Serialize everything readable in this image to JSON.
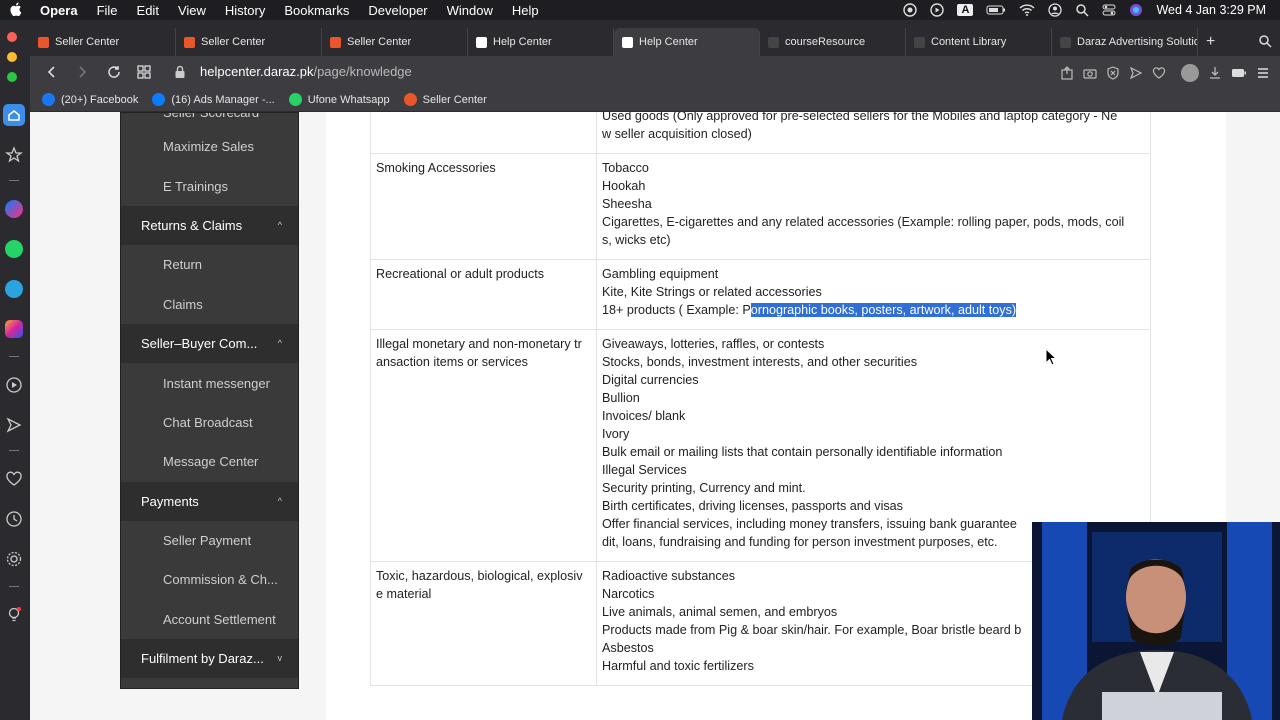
{
  "menubar": {
    "app": "Opera",
    "items": [
      "File",
      "Edit",
      "View",
      "History",
      "Bookmarks",
      "Developer",
      "Window",
      "Help"
    ],
    "input_badge": "A",
    "clock": "Wed 4 Jan  3:29 PM"
  },
  "tabs": [
    {
      "label": "Seller Center",
      "color": "#e8562a",
      "width": 146
    },
    {
      "label": "Seller Center",
      "color": "#e8562a",
      "width": 146
    },
    {
      "label": "Seller Center",
      "color": "#e8562a",
      "width": 146
    },
    {
      "label": "Help Center",
      "color": "#ffffff",
      "width": 146
    },
    {
      "label": "Help Center",
      "color": "#ffffff",
      "width": 146,
      "active": true
    },
    {
      "label": "courseResource",
      "color": "#444444",
      "width": 146
    },
    {
      "label": "Content Library",
      "color": "#444444",
      "width": 146
    },
    {
      "label": "Daraz Advertising Solutio",
      "color": "#444444",
      "width": 146
    }
  ],
  "address": {
    "domain": "helpcenter.daraz.pk",
    "path": "/page/knowledge"
  },
  "bookmarks": [
    {
      "label": "(20+) Facebook",
      "color": "#1877f2"
    },
    {
      "label": "(16) Ads Manager -...",
      "color": "#0a7cff"
    },
    {
      "label": "Ufone Whatsapp",
      "color": "#25d366"
    },
    {
      "label": "Seller Center",
      "color": "#e8562a"
    }
  ],
  "leftnav": [
    {
      "type": "sub",
      "label": "Seller Scorecard",
      "partial": true
    },
    {
      "type": "sub",
      "label": "Maximize Sales"
    },
    {
      "type": "sub",
      "label": "E Trainings"
    },
    {
      "type": "grp",
      "label": "Returns & Claims",
      "caret": "^"
    },
    {
      "type": "sub",
      "label": "Return"
    },
    {
      "type": "sub",
      "label": "Claims"
    },
    {
      "type": "grp",
      "label": "Seller–Buyer Com...",
      "caret": "^"
    },
    {
      "type": "sub",
      "label": "Instant messenger"
    },
    {
      "type": "sub",
      "label": "Chat Broadcast"
    },
    {
      "type": "sub",
      "label": "Message Center"
    },
    {
      "type": "grp",
      "label": "Payments",
      "caret": "^"
    },
    {
      "type": "sub",
      "label": "Seller Payment"
    },
    {
      "type": "sub",
      "label": "Commission & Ch..."
    },
    {
      "type": "sub",
      "label": "Account Settlement"
    },
    {
      "type": "grp",
      "label": "Fulfilment by Daraz...",
      "caret": "v"
    }
  ],
  "table": {
    "rows": [
      {
        "category": "",
        "items": [
          "Used goods (Only approved for pre-selected sellers for the Mobiles and laptop category - Ne",
          "w seller acquisition closed)"
        ]
      },
      {
        "category": "Smoking Accessories",
        "items": [
          "Tobacco",
          "Hookah",
          "Sheesha",
          "Cigarettes, E-cigarettes and any related accessories (Example: rolling paper, pods, mods, coil",
          "s, wicks etc)"
        ]
      },
      {
        "category": "Recreational or adult products",
        "items": [
          "Gambling equipment",
          "Kite, Kite Strings or related accessories"
        ],
        "highlight_line": {
          "prefix": "18+ products ( Example: P",
          "selected": "ornographic books, posters, artwork, adult toys)"
        }
      },
      {
        "category": "Illegal monetary and non-monetary tr ansaction items or services",
        "items": [
          "Giveaways, lotteries, raffles, or contests",
          "Stocks, bonds, investment interests, and other securities",
          "Digital currencies",
          "Bullion",
          "Invoices/ blank",
          "Ivory",
          "Bulk email or mailing lists that contain personally identifiable information",
          "Illegal Services",
          "Security printing, Currency and mint.",
          "Birth certificates, driving licenses, passports and visas",
          "Offer financial services, including money transfers, issuing bank guarantee",
          "dit, loans, fundraising and funding for person investment purposes, etc."
        ]
      },
      {
        "category": "Toxic, hazardous, biological, explosiv e material",
        "items": [
          "Radioactive substances",
          "Narcotics",
          "Live animals, animal semen, and embryos",
          "Products made from Pig & boar skin/hair. For example, Boar bristle beard b",
          "Asbestos",
          "Harmful and toxic fertilizers"
        ]
      }
    ]
  }
}
